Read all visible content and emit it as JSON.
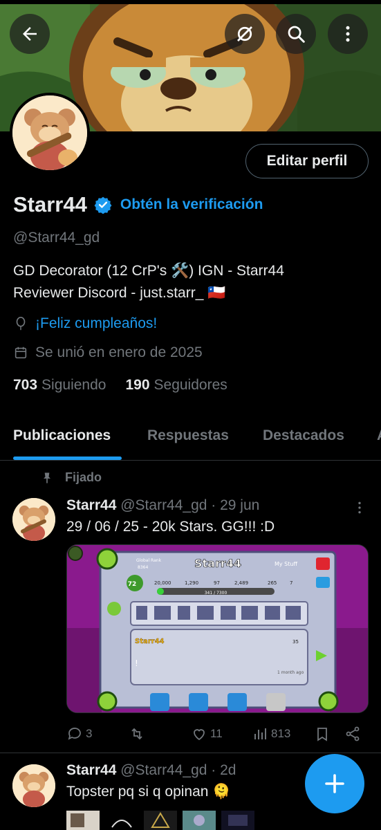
{
  "header": {
    "back_icon": "arrow-left-icon",
    "translate_icon": "globe-off-icon",
    "search_icon": "search-icon",
    "more_icon": "more-vertical-icon"
  },
  "profile": {
    "name": "Starr44",
    "verify_cta": "Obtén la verificación",
    "handle": "@Starr44_gd",
    "bio_line1": "GD Decorator (12 CrP's 🛠️) IGN - Starr44",
    "bio_line2": "Reviewer Discord - just.starr_ 🇨🇱",
    "birthday": "¡Feliz cumpleaños!",
    "joined": "Se unió en enero de 2025",
    "following_count": "703",
    "following_label": "Siguiendo",
    "followers_count": "190",
    "followers_label": "Seguidores",
    "edit_button": "Editar perfil"
  },
  "tabs": [
    "Publicaciones",
    "Respuestas",
    "Destacados",
    "A"
  ],
  "pinned_label": "Fijado",
  "posts": [
    {
      "name": "Starr44",
      "handle": "@Starr44_gd · 29 jun",
      "text": "29 / 06 / 25 - 20k Stars. GG!!! :D",
      "image": {
        "title": "Starr44",
        "global_rank_label": "Global Rank",
        "global_rank": "8364",
        "level": "72",
        "progress": "341 / 7300",
        "stats": [
          "20,000",
          "1,290",
          "97",
          "2,489",
          "265",
          "7"
        ],
        "my_stuff": "My Stuff",
        "comment_name": "Starr44",
        "comment_text": "!",
        "comment_likes": "35",
        "comment_time": "1 month ago"
      },
      "replies": "3",
      "likes": "11",
      "views": "813"
    },
    {
      "name": "Starr44",
      "handle": "@Starr44_gd · 2d",
      "text": "Topster pq si q opinan 🫠"
    }
  ],
  "fab_icon": "plus-icon",
  "colors": {
    "accent": "#1d9bf0",
    "muted": "#71767b",
    "text": "#e7e9ea",
    "bg": "#000000"
  }
}
